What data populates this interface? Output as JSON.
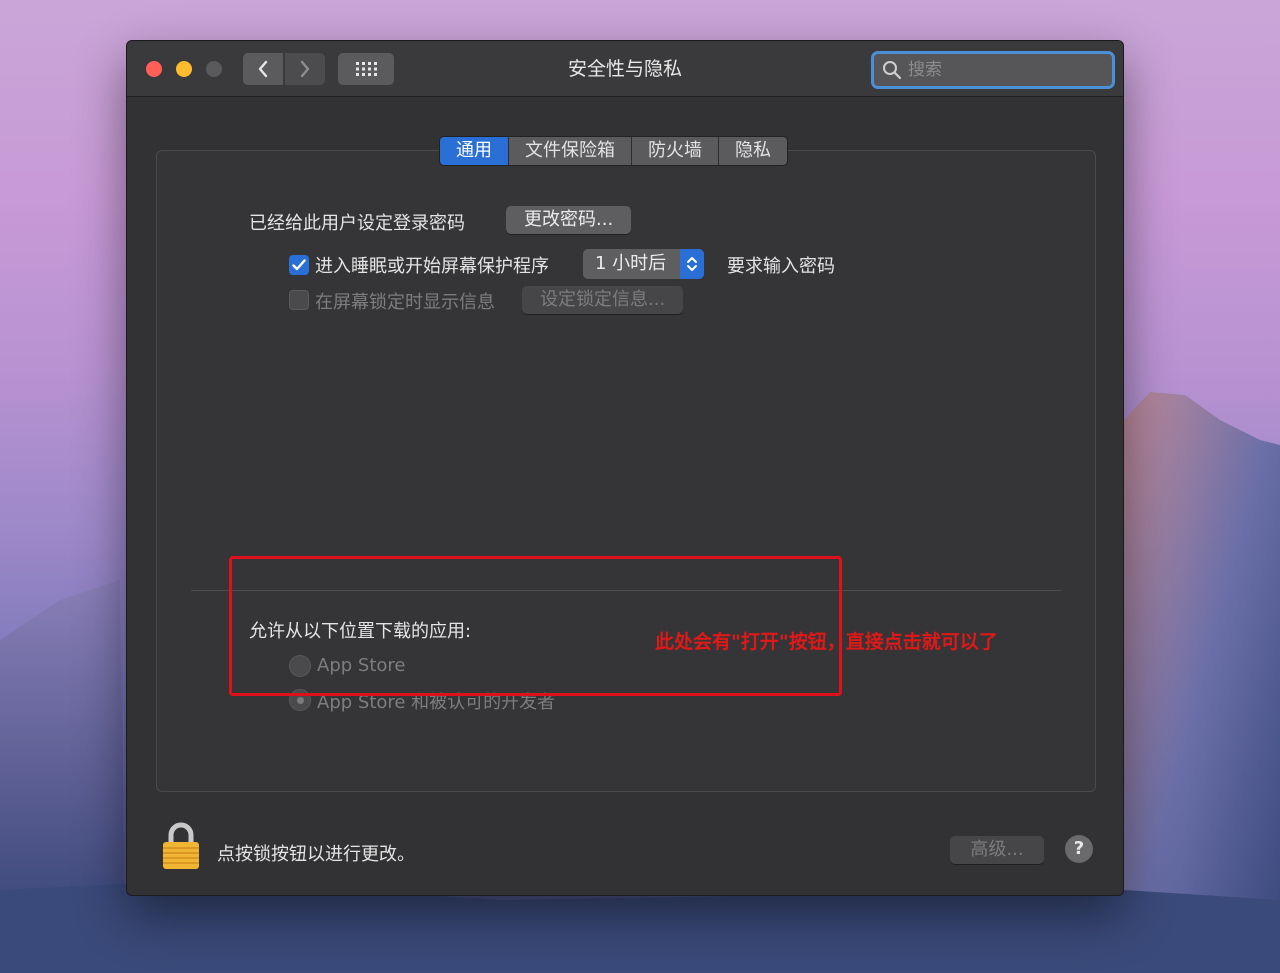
{
  "window": {
    "title": "安全性与隐私",
    "search": {
      "placeholder": "搜索"
    }
  },
  "tabs": [
    {
      "label": "通用",
      "active": true
    },
    {
      "label": "文件保险箱",
      "active": false
    },
    {
      "label": "防火墙",
      "active": false
    },
    {
      "label": "隐私",
      "active": false
    }
  ],
  "general": {
    "password_set_label": "已经给此用户设定登录密码",
    "change_password_button": "更改密码...",
    "require_password": {
      "checked": true,
      "label": "进入睡眠或开始屏幕保护程序",
      "delay_value": "1 小时后",
      "suffix": "要求输入密码"
    },
    "show_message": {
      "checked": false,
      "label": "在屏幕锁定时显示信息",
      "button": "设定锁定信息..."
    }
  },
  "allow_apps": {
    "heading": "允许从以下位置下载的应用:",
    "options": [
      {
        "label": "App Store",
        "selected": false
      },
      {
        "label": "App Store 和被认可的开发者",
        "selected": true
      }
    ]
  },
  "annotation": {
    "text": "此处会有\"打开\"按钮，直接点击就可以了",
    "color": "#e01818"
  },
  "footer": {
    "lock_text": "点按锁按钮以进行更改。",
    "advanced_button": "高级...",
    "help_label": "?"
  },
  "colors": {
    "accent": "#2a6fd6",
    "close": "#ff5f57",
    "minimize": "#febc2e",
    "highlight_border": "#e0101a"
  }
}
